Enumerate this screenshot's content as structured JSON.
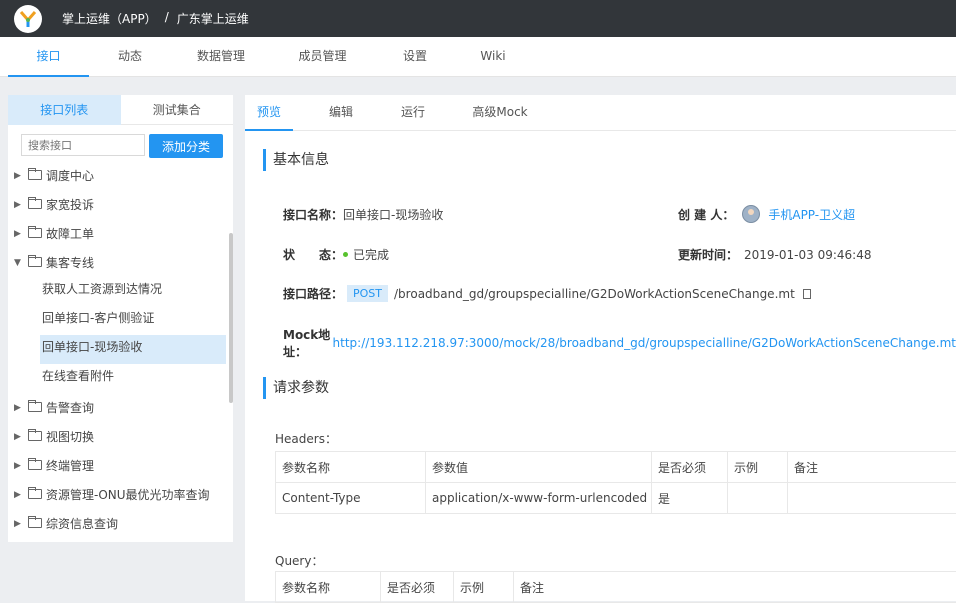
{
  "header": {
    "logo": "Y-logo",
    "project": "掌上运维（APP）",
    "separator": "/",
    "group": "广东掌上运维"
  },
  "top_tabs": [
    "接口",
    "动态",
    "数据管理",
    "成员管理",
    "设置",
    "Wiki"
  ],
  "sidebar": {
    "tabs": [
      "接口列表",
      "测试集合"
    ],
    "search_placeholder": "搜索接口",
    "add_button": "添加分类",
    "folders_top": [
      "调度中心",
      "家宽投诉",
      "故障工单"
    ],
    "expanded_folder": "集客专线",
    "children": [
      "获取人工资源到达情况",
      "回单接口-客户侧验证",
      "回单接口-现场验收",
      "在线查看附件"
    ],
    "folders_bottom": [
      "告警查询",
      "视图切换",
      "终端管理",
      "资源管理-ONU最优光功率查询",
      "综资信息查询"
    ]
  },
  "main": {
    "tabs": [
      "预览",
      "编辑",
      "运行",
      "高级Mock"
    ],
    "basic_title": "基本信息",
    "name_label": "接口名称：",
    "name_value": "回单接口-现场验收",
    "creator_label": "创 建 人：",
    "creator_value": "手机APP-卫义超",
    "status_label": "状　　态：",
    "status_value": "已完成",
    "updated_label": "更新时间：",
    "updated_value": "2019-01-03 09:46:48",
    "path_label": "接口路径：",
    "method": "POST",
    "path_value": "/broadband_gd/groupspecialline/G2DoWorkActionSceneChange.mt",
    "mock_label": "Mock地址：",
    "mock_value": "http://193.112.218.97:3000/mock/28/broadband_gd/groupspecialline/G2DoWorkActionSceneChange.mt",
    "params_title": "请求参数",
    "headers_label": "Headers：",
    "headers_columns": [
      "参数名称",
      "参数值",
      "是否必须",
      "示例",
      "备注"
    ],
    "headers_rows": [
      [
        "Content-Type",
        "application/x-www-form-urlencoded",
        "是",
        "",
        ""
      ]
    ],
    "query_label": "Query：",
    "query_columns": [
      "参数名称",
      "是否必须",
      "示例",
      "备注"
    ]
  },
  "colors": {
    "accent": "#2395f1",
    "topbar": "#32363a",
    "status_green": "#57c22d"
  }
}
